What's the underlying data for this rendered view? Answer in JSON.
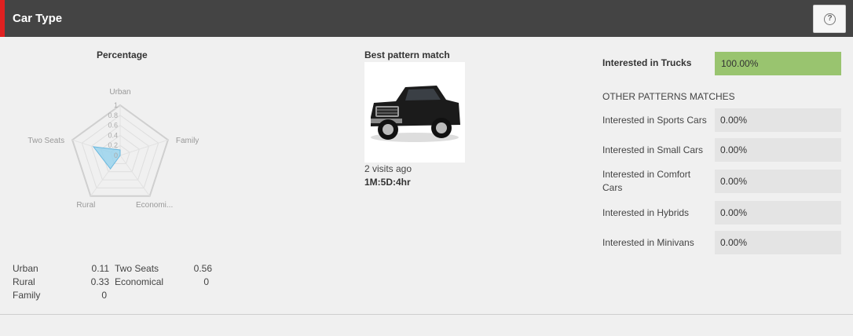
{
  "header": {
    "title": "Car Type",
    "help_icon": "question-circle-icon"
  },
  "colors": {
    "header_bg": "#444444",
    "accent": "#e02020",
    "bar_fill": "#99c46f",
    "bar_bg": "#e4e4e4",
    "radar_fill": "#8fd0ee"
  },
  "radar_section": {
    "title": "Percentage",
    "chart_data": {
      "type": "radar",
      "axes": [
        "Urban",
        "Family",
        "Economi...",
        "Rural",
        "Two Seats"
      ],
      "values": [
        0.11,
        0,
        0,
        0.33,
        0.56
      ],
      "range": [
        0,
        1
      ],
      "ticks": [
        "1",
        "0.8",
        "0.6",
        "0.4",
        "0.2",
        "0"
      ]
    },
    "stats": [
      {
        "label": "Urban",
        "value": "0.11"
      },
      {
        "label": "Rural",
        "value": "0.33"
      },
      {
        "label": "Family",
        "value": "0"
      },
      {
        "label": "Two Seats",
        "value": "0.56"
      },
      {
        "label": "Economical",
        "value": "0"
      }
    ]
  },
  "best_match": {
    "title": "Best pattern match",
    "image": "pickup-truck-image",
    "visits": "2 visits ago",
    "duration": "1M:5D:4hr"
  },
  "interest": {
    "main": {
      "label": "Interested in Trucks",
      "value": "100.00%",
      "fraction": 1.0
    },
    "other_title": "OTHER PATTERNS MATCHES",
    "others": [
      {
        "label": "Interested in Sports Cars",
        "value": "0.00%",
        "fraction": 0
      },
      {
        "label": "Interested in Small Cars",
        "value": "0.00%",
        "fraction": 0
      },
      {
        "label": "Interested in Comfort Cars",
        "value": "0.00%",
        "fraction": 0
      },
      {
        "label": "Interested in Hybrids",
        "value": "0.00%",
        "fraction": 0
      },
      {
        "label": "Interested in Minivans",
        "value": "0.00%",
        "fraction": 0
      }
    ]
  }
}
